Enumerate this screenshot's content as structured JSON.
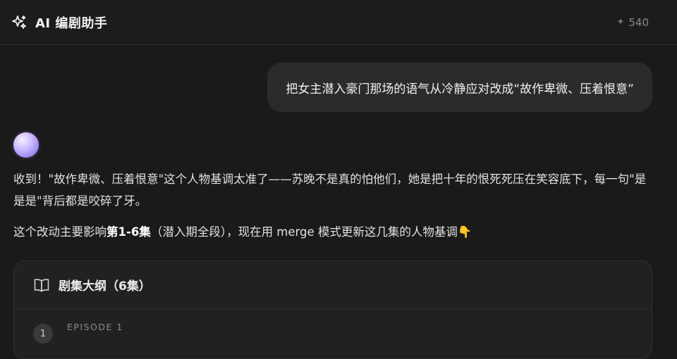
{
  "header": {
    "title": "AI 编剧助手",
    "credits_icon": "sparkle-icon",
    "credits": "540"
  },
  "chat": {
    "user_message": "把女主潜入豪门那场的语气从冷静应对改成“故作卑微、压着恨意”",
    "assistant": {
      "para1": "收到！\"故作卑微、压着恨意\"这个人物基调太准了——苏晚不是真的怕他们，她是把十年的恨死死压在笑容底下，每一句\"是是是\"背后都是咬碎了牙。",
      "para2_before": "这个改动主要影响",
      "para2_bold": "第1-6集",
      "para2_after": "（潜入期全段），现在用 merge 模式更新这几集的人物基调",
      "para2_emoji": "👇"
    },
    "card": {
      "title": "剧集大纲（6集）",
      "episodes": [
        {
          "number": "1",
          "label": "EPISODE 1"
        }
      ]
    }
  },
  "colors": {
    "background": "#1a1a1a",
    "bubble": "#2b2b2b",
    "card": "#212121",
    "avatar_accent": "#9b86f0"
  }
}
